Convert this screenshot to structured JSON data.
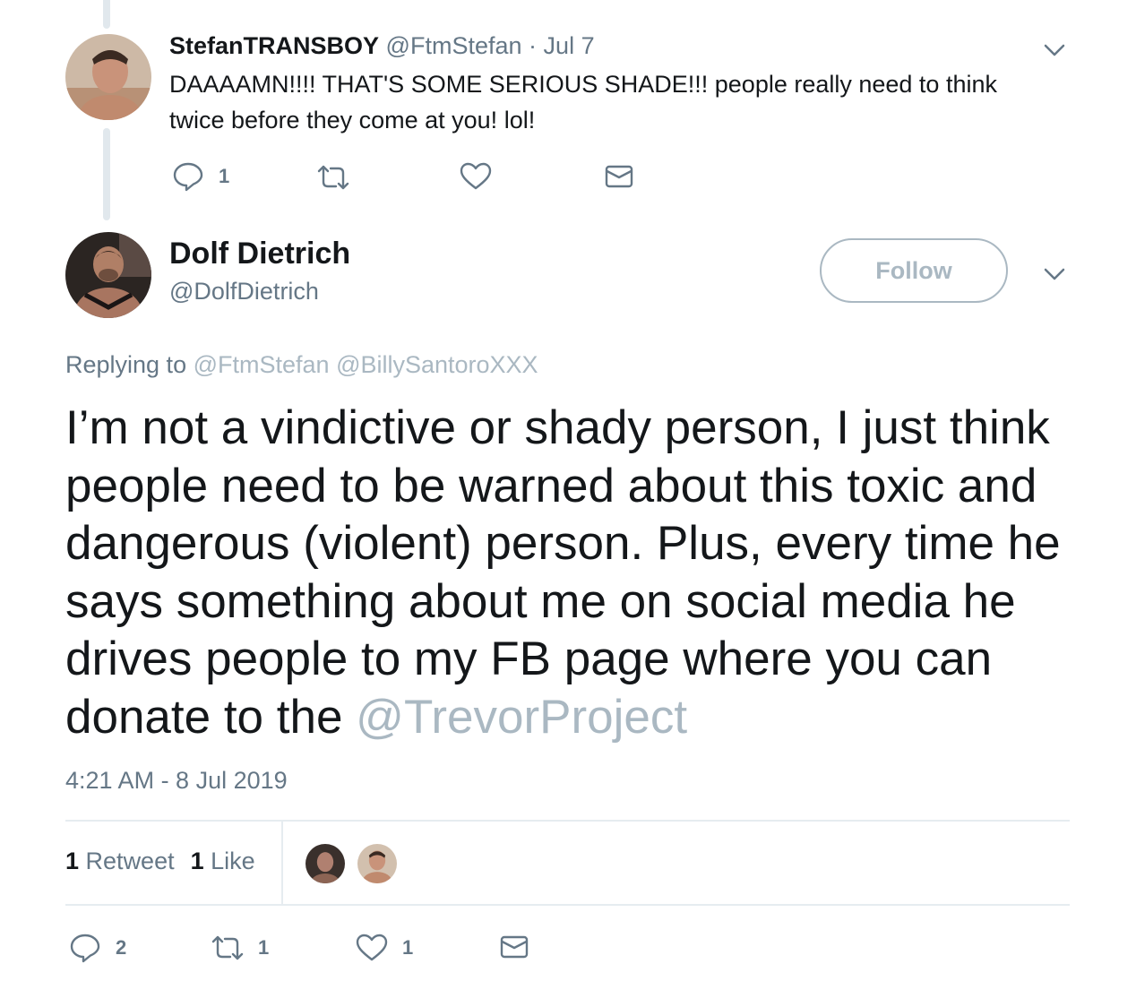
{
  "reply": {
    "display_name": "StefanTRANSBOY",
    "handle": "@FtmStefan",
    "separator": "·",
    "date": "Jul 7",
    "text": "DAAAAMN!!!! THAT'S SOME SERIOUS SHADE!!!  people really need to think twice before they come at you! lol!",
    "actions": {
      "reply_icon": "reply-bubble-icon",
      "reply_count": "1",
      "retweet_icon": "retweet-icon",
      "like_icon": "heart-icon",
      "dm_icon": "envelope-icon"
    }
  },
  "main": {
    "display_name": "Dolf Dietrich",
    "handle": "@DolfDietrich",
    "follow_label": "Follow",
    "replying_prefix": "Replying to",
    "replying_mentions": "@FtmStefan @BillySantoroXXX",
    "text": "I’m not a vindictive or shady person, I just think people need to be warned about this toxic and dangerous (violent) person. Plus, every time he says something about me on social media he drives people to my FB page where you can donate to the",
    "text_link": "@TrevorProject",
    "timestamp": "4:21 AM - 8 Jul 2019",
    "stats": {
      "retweet_count": "1",
      "retweet_label": "Retweet",
      "like_count": "1",
      "like_label": "Like"
    },
    "actions": {
      "reply_count": "2",
      "retweet_count": "1",
      "like_count": "1"
    }
  },
  "colors": {
    "text_primary": "#14171a",
    "text_secondary": "#657786",
    "link_muted": "#aab8c2",
    "divider": "#e6ecf0"
  }
}
